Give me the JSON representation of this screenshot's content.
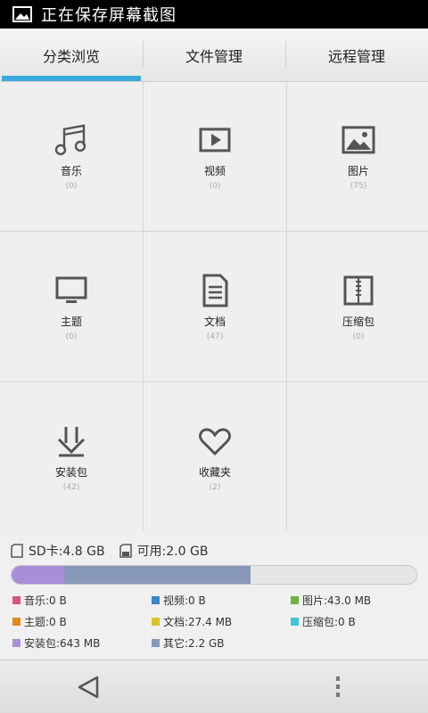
{
  "status_bar": {
    "text": "正在保存屏幕截图",
    "icon": "image-icon"
  },
  "tabs": [
    {
      "label": "分类浏览",
      "active": true
    },
    {
      "label": "文件管理",
      "active": false
    },
    {
      "label": "远程管理",
      "active": false
    }
  ],
  "categories": [
    {
      "label": "音乐",
      "count": "(0)",
      "icon": "music-icon"
    },
    {
      "label": "视频",
      "count": "(0)",
      "icon": "video-icon"
    },
    {
      "label": "图片",
      "count": "(75)",
      "icon": "picture-icon"
    },
    {
      "label": "主题",
      "count": "(0)",
      "icon": "theme-icon"
    },
    {
      "label": "文档",
      "count": "(47)",
      "icon": "document-icon"
    },
    {
      "label": "压缩包",
      "count": "(0)",
      "icon": "archive-icon"
    },
    {
      "label": "安装包",
      "count": "(42)",
      "icon": "install-icon"
    },
    {
      "label": "收藏夹",
      "count": "(2)",
      "icon": "favorites-icon"
    }
  ],
  "storage": {
    "sd_label": "SD卡:4.8 GB",
    "available_label": "可用:2.0 GB",
    "bar_segments": [
      {
        "name": "安装包",
        "fraction": 0.13,
        "color": "#a88ed8"
      },
      {
        "name": "其它",
        "fraction": 0.46,
        "color": "#8898b8"
      }
    ],
    "legend": [
      {
        "label": "音乐:0 B",
        "color": "#d9557a"
      },
      {
        "label": "视频:0 B",
        "color": "#3a86c8"
      },
      {
        "label": "图片:43.0 MB",
        "color": "#6db33f"
      },
      {
        "label": "主题:0 B",
        "color": "#e08a1e"
      },
      {
        "label": "文档:27.4 MB",
        "color": "#d8c42a"
      },
      {
        "label": "压缩包:0 B",
        "color": "#3fc6d2"
      },
      {
        "label": "安装包:643 MB",
        "color": "#a88ed8"
      },
      {
        "label": "其它:2.2 GB",
        "color": "#8898b8"
      }
    ]
  },
  "nav": {
    "back_icon": "back-triangle-icon",
    "menu_icon": "overflow-menu-icon"
  }
}
